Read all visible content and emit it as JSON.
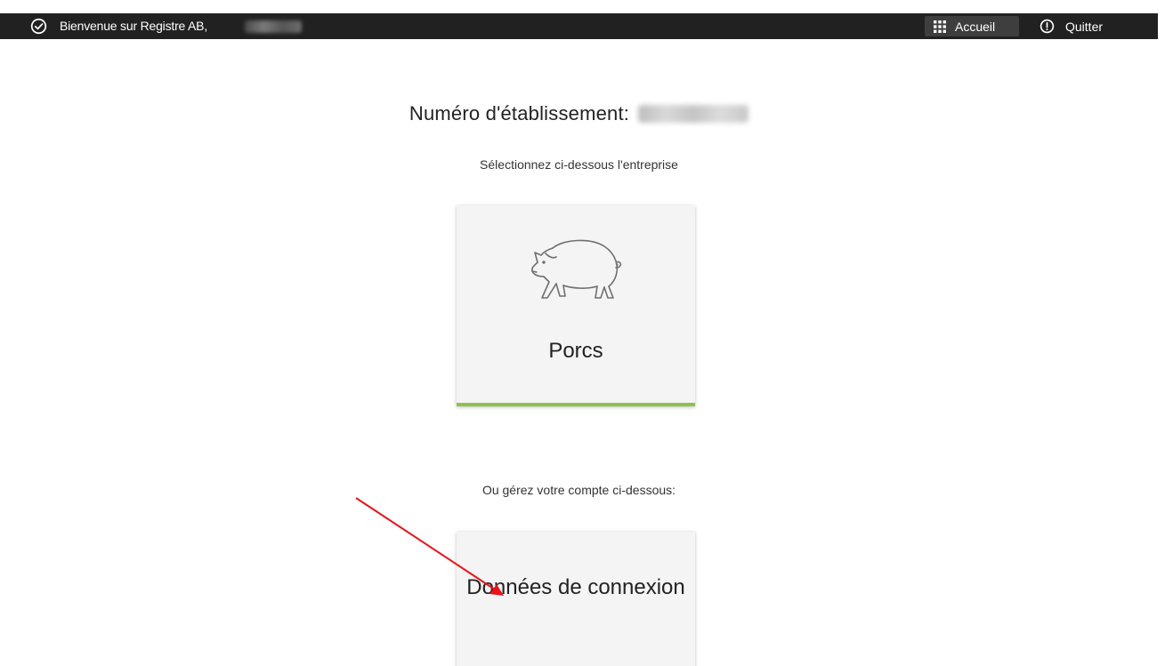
{
  "topbar": {
    "welcome_text": "Bienvenue sur Registre AB,",
    "home_label": "Accueil",
    "quit_label": "Quitter",
    "check_icon": "check-circle-icon",
    "home_icon": "grid-icon",
    "quit_icon": "power-icon"
  },
  "main": {
    "establishment_label": "Numéro d'établissement:",
    "select_prompt": "Sélectionnez ci-dessous l'entreprise",
    "manage_prompt": "Ou gérez votre compte ci-dessous:"
  },
  "cards": {
    "pig_label": "Porcs",
    "pig_icon": "pig-icon",
    "pig_accent": "#8dc14d",
    "account_label": "Données de connexion"
  },
  "colors": {
    "topbar_bg": "#212121",
    "card_bg": "#f4f4f4",
    "annotation": "#e8141b"
  }
}
